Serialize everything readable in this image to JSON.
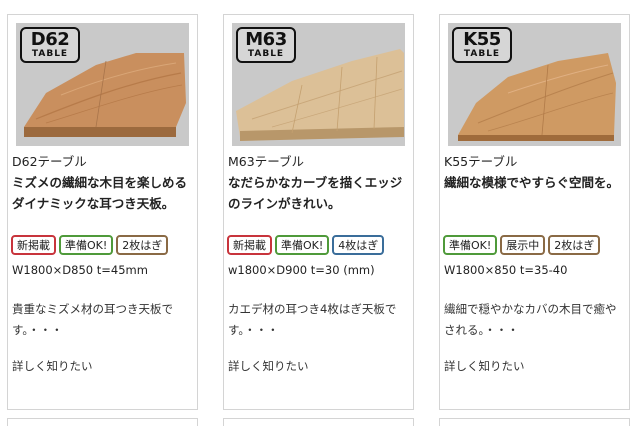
{
  "products": [
    {
      "logo_code": "D62",
      "logo_word": "TABLE",
      "name": "D62テーブル",
      "catch": "ミズメの繊細な木目を楽しめるダイナミックな耳つき天板。",
      "tags": [
        "新掲載",
        "準備OK!",
        "2枚はぎ"
      ],
      "size": "W1800×D850 t=45mm",
      "description": "貴重なミズメ材の耳つき天板です。・・・",
      "more": "詳しく知りたい",
      "wood_color": "#c98f5e"
    },
    {
      "logo_code": "M63",
      "logo_word": "TABLE",
      "name": "M63テーブル",
      "catch": "なだらかなカーブを描くエッジのラインがきれい。",
      "tags": [
        "新掲載",
        "準備OK!",
        "4枚はぎ"
      ],
      "size": "w1800×D900 t=30 (mm)",
      "description": "カエデ材の耳つき4枚はぎ天板です。・・・",
      "more": "詳しく知りたい",
      "wood_color": "#dcc097"
    },
    {
      "logo_code": "K55",
      "logo_word": "TABLE",
      "name": "K55テーブル",
      "catch": "繊細な模様でやすらぐ空間を。",
      "tags": [
        "準備OK!",
        "展示中",
        "2枚はぎ"
      ],
      "size": "W1800×850 t=35-40",
      "description": "繊細で穏やかなカバの木目で癒やされる。・・・",
      "more": "詳しく知りたい",
      "wood_color": "#cf9a63"
    }
  ]
}
